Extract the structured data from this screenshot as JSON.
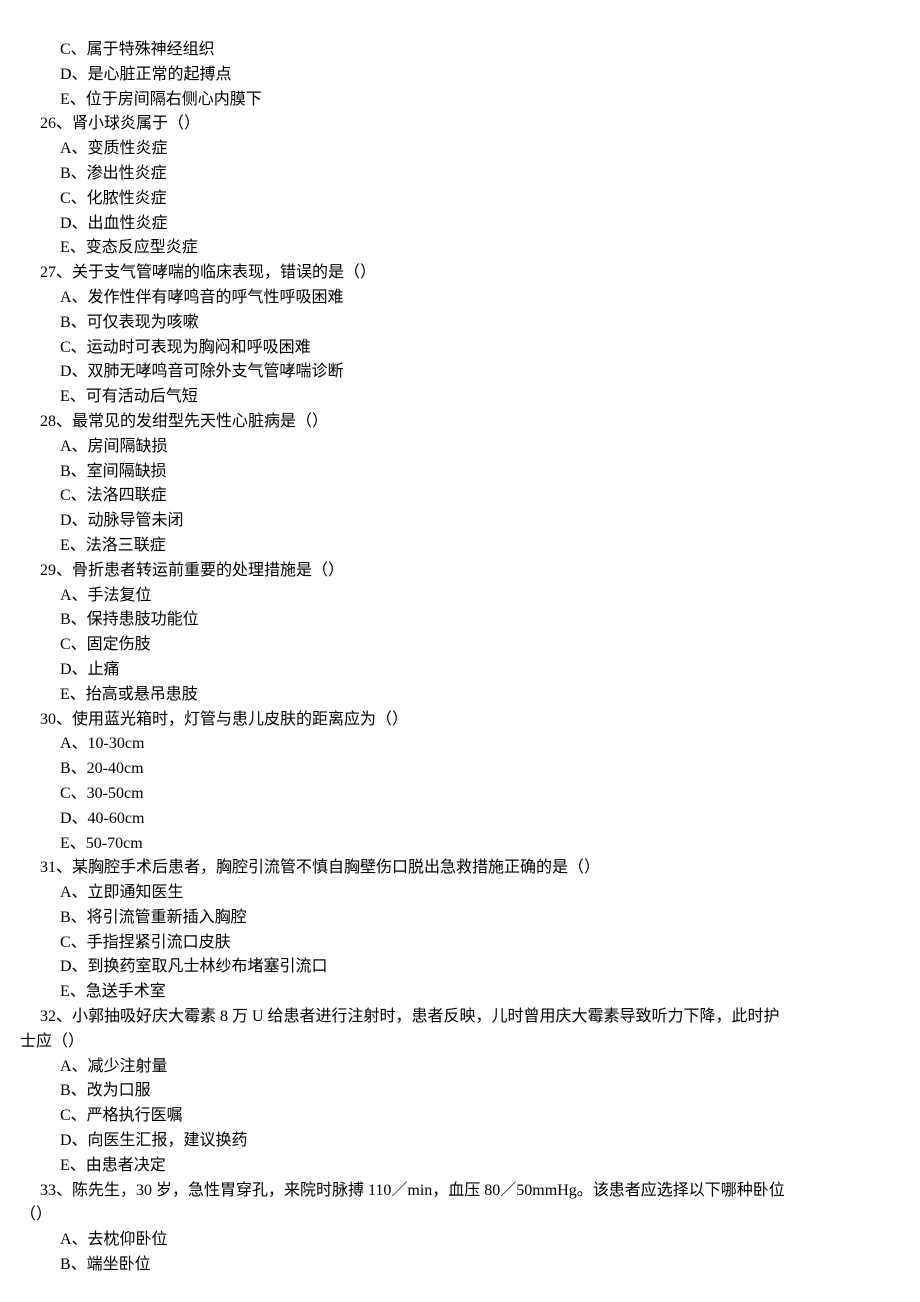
{
  "lines": [
    {
      "cls": "option",
      "text": "C、属于特殊神经组织"
    },
    {
      "cls": "option",
      "text": "D、是心脏正常的起搏点"
    },
    {
      "cls": "option",
      "text": "E、位于房间隔右侧心内膜下"
    },
    {
      "cls": "question",
      "text": "26、肾小球炎属于（）"
    },
    {
      "cls": "option",
      "text": "A、变质性炎症"
    },
    {
      "cls": "option",
      "text": "B、渗出性炎症"
    },
    {
      "cls": "option",
      "text": "C、化脓性炎症"
    },
    {
      "cls": "option",
      "text": "D、出血性炎症"
    },
    {
      "cls": "option",
      "text": "E、变态反应型炎症"
    },
    {
      "cls": "question",
      "text": "27、关于支气管哮喘的临床表现，错误的是（）"
    },
    {
      "cls": "option",
      "text": "A、发作性伴有哮鸣音的呼气性呼吸困难"
    },
    {
      "cls": "option",
      "text": "B、可仅表现为咳嗽"
    },
    {
      "cls": "option",
      "text": "C、运动时可表现为胸闷和呼吸困难"
    },
    {
      "cls": "option",
      "text": "D、双肺无哮鸣音可除外支气管哮喘诊断"
    },
    {
      "cls": "option",
      "text": "E、可有活动后气短"
    },
    {
      "cls": "question",
      "text": "28、最常见的发绀型先天性心脏病是（）"
    },
    {
      "cls": "option",
      "text": "A、房间隔缺损"
    },
    {
      "cls": "option",
      "text": "B、室间隔缺损"
    },
    {
      "cls": "option",
      "text": "C、法洛四联症"
    },
    {
      "cls": "option",
      "text": "D、动脉导管未闭"
    },
    {
      "cls": "option",
      "text": "E、法洛三联症"
    },
    {
      "cls": "question",
      "text": "29、骨折患者转运前重要的处理措施是（）"
    },
    {
      "cls": "option",
      "text": "A、手法复位"
    },
    {
      "cls": "option",
      "text": "B、保持患肢功能位"
    },
    {
      "cls": "option",
      "text": "C、固定伤肢"
    },
    {
      "cls": "option",
      "text": "D、止痛"
    },
    {
      "cls": "option",
      "text": "E、抬高或悬吊患肢"
    },
    {
      "cls": "question",
      "text": "30、使用蓝光箱时，灯管与患儿皮肤的距离应为（）"
    },
    {
      "cls": "option",
      "text": "A、10-30cm"
    },
    {
      "cls": "option",
      "text": "B、20-40cm"
    },
    {
      "cls": "option",
      "text": "C、30-50cm"
    },
    {
      "cls": "option",
      "text": "D、40-60cm"
    },
    {
      "cls": "option",
      "text": "E、50-70cm"
    },
    {
      "cls": "question",
      "text": "31、某胸腔手术后患者，胸腔引流管不慎自胸壁伤口脱出急救措施正确的是（）"
    },
    {
      "cls": "option",
      "text": "A、立即通知医生"
    },
    {
      "cls": "option",
      "text": "B、将引流管重新插入胸腔"
    },
    {
      "cls": "option",
      "text": "C、手指捏紧引流口皮肤"
    },
    {
      "cls": "option",
      "text": "D、到换药室取凡士林纱布堵塞引流口"
    },
    {
      "cls": "option",
      "text": "E、急送手术室"
    },
    {
      "cls": "question",
      "text": "32、小郭抽吸好庆大霉素 8 万 U 给患者进行注射时，患者反映，儿时曾用庆大霉素导致听力下降，此时护"
    },
    {
      "cls": "wrap",
      "text": "士应（）"
    },
    {
      "cls": "option",
      "text": "A、减少注射量"
    },
    {
      "cls": "option",
      "text": "B、改为口服"
    },
    {
      "cls": "option",
      "text": "C、严格执行医嘱"
    },
    {
      "cls": "option",
      "text": "D、向医生汇报，建议换药"
    },
    {
      "cls": "option",
      "text": "E、由患者决定"
    },
    {
      "cls": "question",
      "text": "33、陈先生，30 岁，急性胃穿孔，来院时脉搏 110／min，血压 80／50mmHg。该患者应选择以下哪种卧位"
    },
    {
      "cls": "wrap",
      "text": "（）"
    },
    {
      "cls": "option",
      "text": "A、去枕仰卧位"
    },
    {
      "cls": "option",
      "text": "B、端坐卧位"
    }
  ]
}
